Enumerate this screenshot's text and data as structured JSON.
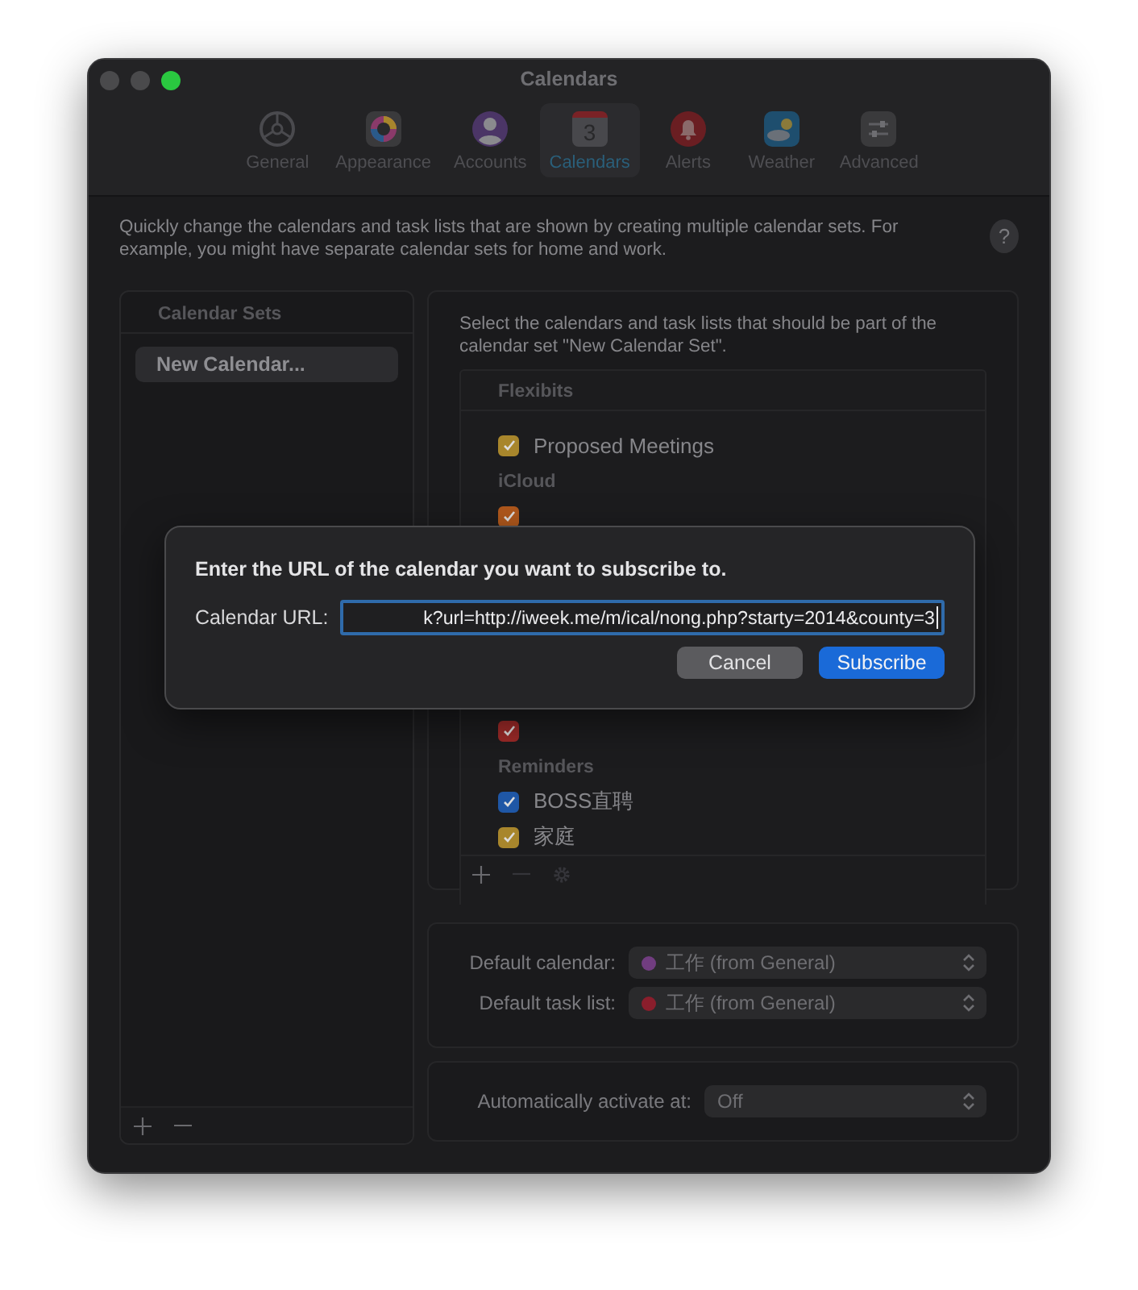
{
  "window": {
    "title": "Calendars"
  },
  "toolbar": [
    {
      "label": "General",
      "kind": "general",
      "selected": false
    },
    {
      "label": "Appearance",
      "kind": "appearance",
      "selected": false
    },
    {
      "label": "Accounts",
      "kind": "accounts",
      "selected": false
    },
    {
      "label": "Calendars",
      "kind": "calendar",
      "icon_text": "3",
      "selected": true
    },
    {
      "label": "Alerts",
      "kind": "alerts",
      "selected": false
    },
    {
      "label": "Weather",
      "kind": "weather",
      "selected": false
    },
    {
      "label": "Advanced",
      "kind": "advanced",
      "selected": false
    }
  ],
  "description": "Quickly change the calendars and task lists that are shown by creating multiple calendar sets. For example, you might have separate calendar sets for home and work.",
  "help_button": "?",
  "calendar_sets": {
    "header": "Calendar Sets",
    "items": [
      {
        "label": "New Calendar...",
        "selected": true
      }
    ],
    "buttons": [
      {
        "kind": "plus",
        "disabled": false
      },
      {
        "kind": "minus",
        "disabled": false
      }
    ]
  },
  "selection": {
    "instructions": "Select the calendars and task lists that should be part of the calendar set \"New Calendar Set\".",
    "header": "Flexibits",
    "rows": [
      {
        "kind": "item",
        "label": "Proposed Meetings",
        "checked": true,
        "color": "#a8862c"
      },
      {
        "kind": "header",
        "label": "iCloud"
      },
      {
        "kind": "partial",
        "checked": true,
        "color": "#b0581c"
      },
      {
        "kind": "partial",
        "checked": true,
        "color": "#9c2a28"
      },
      {
        "kind": "header",
        "label": "Reminders"
      },
      {
        "kind": "item",
        "label": "BOSS直聘",
        "checked": true,
        "color": "#1f57a6"
      },
      {
        "kind": "item",
        "label": "家庭",
        "checked": true,
        "color": "#a8862c"
      }
    ],
    "buttons": [
      {
        "kind": "plus",
        "disabled": false
      },
      {
        "kind": "minus",
        "disabled": true
      },
      {
        "kind": "gear",
        "disabled": true
      }
    ]
  },
  "defaults": [
    {
      "label": "Default calendar:",
      "value": "工作 (from General)",
      "color": "#713d80"
    },
    {
      "label": "Default task list:",
      "value": "工作 (from General)",
      "color": "#8a1e2c"
    }
  ],
  "auto_activate": {
    "label": "Automatically activate at:",
    "value": "Off"
  },
  "dialog": {
    "message": "Enter the URL of the calendar you want to subscribe to.",
    "field_label": "Calendar URL:",
    "value": "k?url=http://iweek.me/m/ical/nong.php?starty=2014&county=3",
    "buttons": [
      {
        "label": "Cancel",
        "kind": "secondary"
      },
      {
        "label": "Subscribe",
        "kind": "primary"
      }
    ]
  }
}
